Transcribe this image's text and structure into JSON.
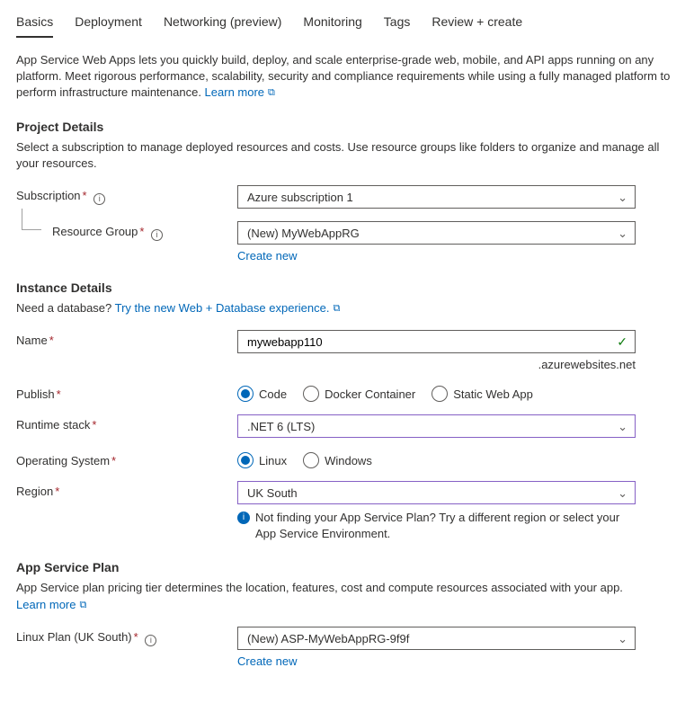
{
  "tabs": [
    "Basics",
    "Deployment",
    "Networking (preview)",
    "Monitoring",
    "Tags",
    "Review + create"
  ],
  "intro": {
    "text": "App Service Web Apps lets you quickly build, deploy, and scale enterprise-grade web, mobile, and API apps running on any platform. Meet rigorous performance, scalability, security and compliance requirements while using a fully managed platform to perform infrastructure maintenance.  ",
    "learn_more": "Learn more"
  },
  "project": {
    "heading": "Project Details",
    "desc": "Select a subscription to manage deployed resources and costs. Use resource groups like folders to organize and manage all your resources.",
    "subscription_label": "Subscription",
    "subscription_value": "Azure subscription 1",
    "rg_label": "Resource Group",
    "rg_value": "(New) MyWebAppRG",
    "create_new": "Create new"
  },
  "instance": {
    "heading": "Instance Details",
    "db_prompt": "Need a database? ",
    "db_link": "Try the new Web + Database experience.",
    "name_label": "Name",
    "name_value": "mywebapp110",
    "name_suffix": ".azurewebsites.net",
    "publish_label": "Publish",
    "publish_options": [
      "Code",
      "Docker Container",
      "Static Web App"
    ],
    "runtime_label": "Runtime stack",
    "runtime_value": ".NET 6 (LTS)",
    "os_label": "Operating System",
    "os_options": [
      "Linux",
      "Windows"
    ],
    "region_label": "Region",
    "region_value": "UK South",
    "region_hint": "Not finding your App Service Plan? Try a different region or select your App Service Environment."
  },
  "plan": {
    "heading": "App Service Plan",
    "desc": "App Service plan pricing tier determines the location, features, cost and compute resources associated with your app.",
    "learn_more": "Learn more",
    "plan_label": "Linux Plan (UK South)",
    "plan_value": "(New) ASP-MyWebAppRG-9f9f",
    "create_new": "Create new"
  }
}
